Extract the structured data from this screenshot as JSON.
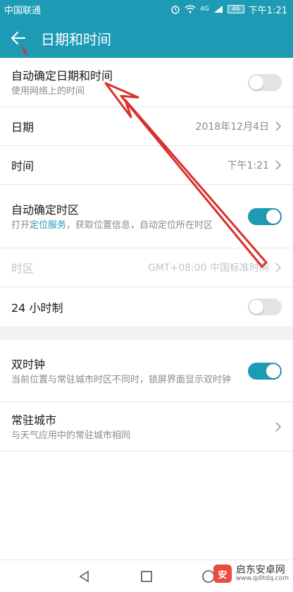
{
  "status_bar": {
    "carrier": "中国联通",
    "network": "4G",
    "battery": "46",
    "time": "下午1:21"
  },
  "app_bar": {
    "title": "日期和时间",
    "back_icon": "arrow-left-icon"
  },
  "settings": {
    "auto_datetime": {
      "label": "自动确定日期和时间",
      "sub": "使用网络上的时间",
      "on": false
    },
    "date": {
      "label": "日期",
      "value": "2018年12月4日"
    },
    "time": {
      "label": "时间",
      "value": "下午1:21"
    },
    "auto_timezone": {
      "label": "自动确定时区",
      "sub_prefix": "打开",
      "sub_link": "定位服务",
      "sub_suffix": "，获取位置信息，自动定位所在时区",
      "on": true
    },
    "timezone": {
      "label": "时区",
      "value": "GMT+08:00 中国标准时间",
      "disabled": true
    },
    "hour24": {
      "label": "24 小时制",
      "on": false
    },
    "dual_clock": {
      "label": "双时钟",
      "sub": "当前位置与常驻城市时区不同时，锁屏界面显示双时钟",
      "on": true
    },
    "home_city": {
      "label": "常驻城市",
      "sub": "与天气应用中的常驻城市相同"
    }
  },
  "watermark": {
    "logo": "安",
    "name": "启东安卓网",
    "url": "www.qdltdq.com"
  },
  "colors": {
    "accent": "#1d9bb5",
    "annotation": "#d9302c"
  }
}
